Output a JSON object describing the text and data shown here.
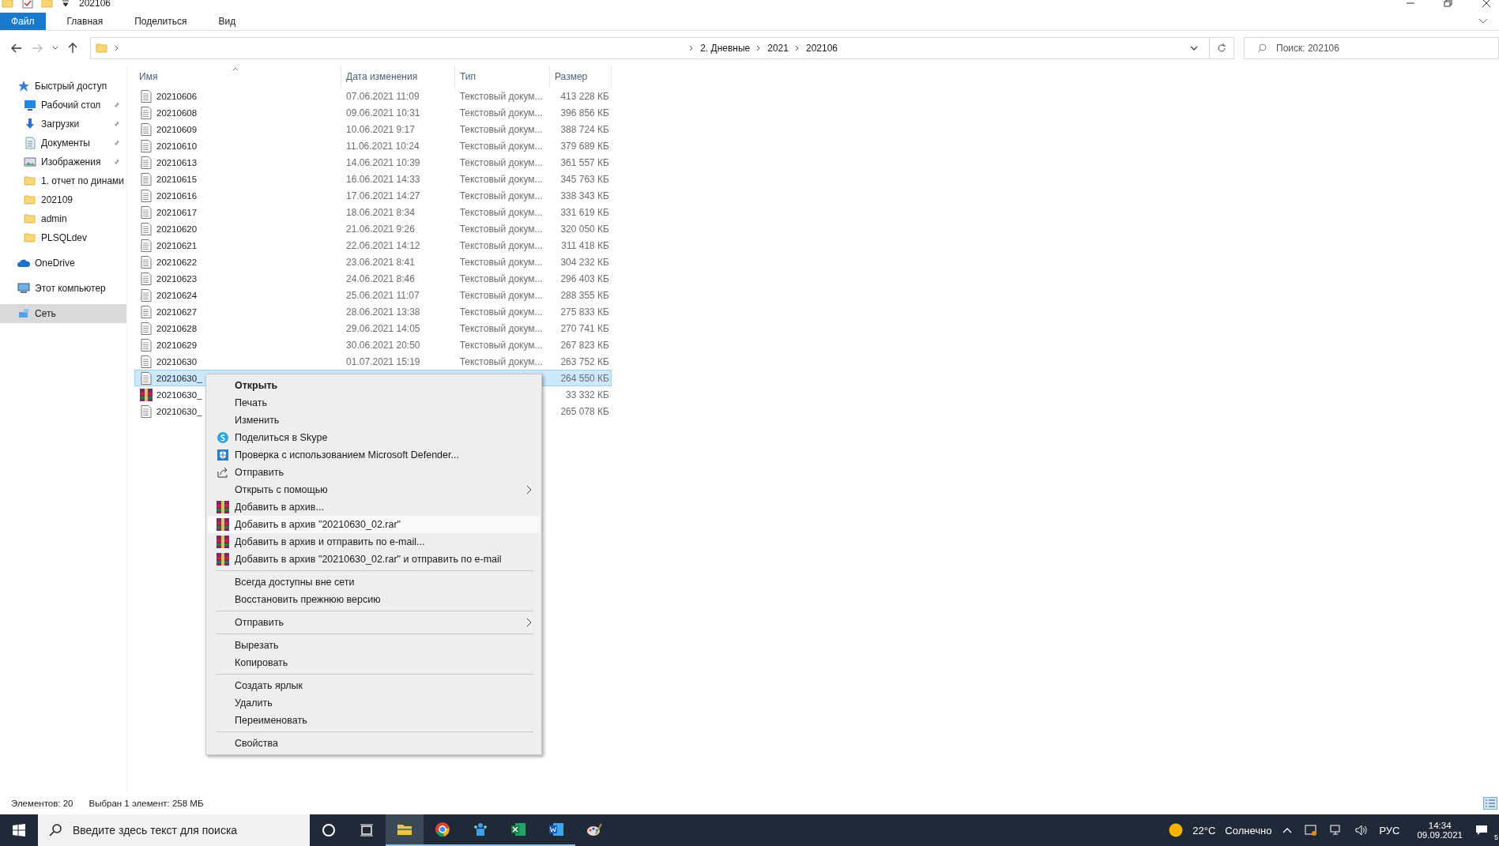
{
  "window": {
    "title": "202106"
  },
  "ribbon": {
    "tabs": [
      {
        "label": "Файл",
        "selected": true
      },
      {
        "label": "Главная",
        "selected": false
      },
      {
        "label": "Поделиться",
        "selected": false
      },
      {
        "label": "Вид",
        "selected": false
      }
    ]
  },
  "address": {
    "breadcrumb": [
      "2. Дневные",
      "2021",
      "202106"
    ],
    "search": {
      "placeholder": "Поиск: 202106"
    }
  },
  "sidebar": {
    "items": [
      {
        "label": "Быстрый доступ",
        "kind": "star",
        "pinned": false,
        "selected": false,
        "children": [
          {
            "label": "Рабочий стол",
            "kind": "desktop",
            "pinned": true,
            "selected": false
          },
          {
            "label": "Загрузки",
            "kind": "download",
            "pinned": true,
            "selected": false
          },
          {
            "label": "Документы",
            "kind": "documents",
            "pinned": true,
            "selected": false
          },
          {
            "label": "Изображения",
            "kind": "pictures",
            "pinned": true,
            "selected": false
          },
          {
            "label": "1. отчет по динами",
            "kind": "folder",
            "pinned": false,
            "selected": false
          },
          {
            "label": "202109",
            "kind": "folder",
            "pinned": false,
            "selected": false
          },
          {
            "label": "admin",
            "kind": "folder",
            "pinned": false,
            "selected": false
          },
          {
            "label": "PLSQLdev",
            "kind": "folder",
            "pinned": false,
            "selected": false
          }
        ]
      },
      {
        "label": "OneDrive",
        "kind": "cloud",
        "pinned": false,
        "selected": false
      },
      {
        "label": "Этот компьютер",
        "kind": "computer",
        "pinned": false,
        "selected": false
      },
      {
        "label": "Сеть",
        "kind": "network",
        "pinned": false,
        "selected": true
      }
    ]
  },
  "table": {
    "columns": [
      "Имя",
      "Дата изменения",
      "Тип",
      "Размер"
    ],
    "rows": [
      {
        "kind": "text",
        "name": "20210606",
        "date": "07.06.2021 11:09",
        "type": "Текстовый докум...",
        "size": "413 228 КБ",
        "selected": false
      },
      {
        "kind": "text",
        "name": "20210608",
        "date": "09.06.2021 10:31",
        "type": "Текстовый докум...",
        "size": "396 856 КБ",
        "selected": false
      },
      {
        "kind": "text",
        "name": "20210609",
        "date": "10.06.2021 9:17",
        "type": "Текстовый докум...",
        "size": "388 724 КБ",
        "selected": false
      },
      {
        "kind": "text",
        "name": "20210610",
        "date": "11.06.2021 10:24",
        "type": "Текстовый докум...",
        "size": "379 689 КБ",
        "selected": false
      },
      {
        "kind": "text",
        "name": "20210613",
        "date": "14.06.2021 10:39",
        "type": "Текстовый докум...",
        "size": "361 557 КБ",
        "selected": false
      },
      {
        "kind": "text",
        "name": "20210615",
        "date": "16.06.2021 14:33",
        "type": "Текстовый докум...",
        "size": "345 763 КБ",
        "selected": false
      },
      {
        "kind": "text",
        "name": "20210616",
        "date": "17.06.2021 14:27",
        "type": "Текстовый докум...",
        "size": "338 343 КБ",
        "selected": false
      },
      {
        "kind": "text",
        "name": "20210617",
        "date": "18.06.2021 8:34",
        "type": "Текстовый докум...",
        "size": "331 619 КБ",
        "selected": false
      },
      {
        "kind": "text",
        "name": "20210620",
        "date": "21.06.2021 9:26",
        "type": "Текстовый докум...",
        "size": "320 050 КБ",
        "selected": false
      },
      {
        "kind": "text",
        "name": "20210621",
        "date": "22.06.2021 14:12",
        "type": "Текстовый докум...",
        "size": "311 418 КБ",
        "selected": false
      },
      {
        "kind": "text",
        "name": "20210622",
        "date": "23.06.2021 8:41",
        "type": "Текстовый докум...",
        "size": "304 232 КБ",
        "selected": false
      },
      {
        "kind": "text",
        "name": "20210623",
        "date": "24.06.2021 8:46",
        "type": "Текстовый докум...",
        "size": "296 403 КБ",
        "selected": false
      },
      {
        "kind": "text",
        "name": "20210624",
        "date": "25.06.2021 11:07",
        "type": "Текстовый докум...",
        "size": "288 355 КБ",
        "selected": false
      },
      {
        "kind": "text",
        "name": "20210627",
        "date": "28.06.2021 13:38",
        "type": "Текстовый докум...",
        "size": "275 833 КБ",
        "selected": false
      },
      {
        "kind": "text",
        "name": "20210628",
        "date": "29.06.2021 14:05",
        "type": "Текстовый докум...",
        "size": "270 741 КБ",
        "selected": false
      },
      {
        "kind": "text",
        "name": "20210629",
        "date": "30.06.2021 20:50",
        "type": "Текстовый докум...",
        "size": "267 823 КБ",
        "selected": false
      },
      {
        "kind": "text",
        "name": "20210630",
        "date": "01.07.2021 15:19",
        "type": "Текстовый докум...",
        "size": "263 752 КБ",
        "selected": false
      },
      {
        "kind": "text",
        "name": "20210630_",
        "size": "264 550 КБ",
        "selected": true
      },
      {
        "kind": "archive",
        "name": "20210630_",
        "size": "33 332 КБ",
        "selected": false
      },
      {
        "kind": "text",
        "name": "20210630_",
        "size": "265 078 КБ",
        "selected": false
      }
    ]
  },
  "context_menu": {
    "groups": [
      [
        {
          "label": "Открыть",
          "kind": "plain",
          "default": true,
          "submenu": false,
          "highlighted": false
        },
        {
          "label": "Печать",
          "kind": "plain",
          "default": false,
          "submenu": false,
          "highlighted": false
        },
        {
          "label": "Изменить",
          "kind": "plain",
          "default": false,
          "submenu": false,
          "highlighted": false
        },
        {
          "label": "Поделиться в Skype",
          "kind": "skype",
          "default": false,
          "submenu": false,
          "highlighted": false
        },
        {
          "label": "Проверка с использованием Microsoft Defender...",
          "kind": "shield",
          "default": false,
          "submenu": false,
          "highlighted": false
        },
        {
          "label": "Отправить",
          "kind": "share",
          "default": false,
          "submenu": false,
          "highlighted": false
        },
        {
          "label": "Открыть с помощью",
          "kind": "plain",
          "default": false,
          "submenu": true,
          "highlighted": false
        },
        {
          "label": "Добавить в архив...",
          "kind": "archive",
          "default": false,
          "submenu": false,
          "highlighted": false
        },
        {
          "label": "Добавить в архив \"20210630_02.rar\"",
          "kind": "archive",
          "default": false,
          "submenu": false,
          "highlighted": true
        },
        {
          "label": "Добавить в архив и отправить по e-mail...",
          "kind": "archive",
          "default": false,
          "submenu": false,
          "highlighted": false
        },
        {
          "label": "Добавить в архив \"20210630_02.rar\" и отправить по e-mail",
          "kind": "archive",
          "default": false,
          "submenu": false,
          "highlighted": false
        }
      ],
      [
        {
          "label": "Всегда доступны вне сети",
          "kind": "plain",
          "default": false,
          "submenu": false,
          "highlighted": false
        },
        {
          "label": "Восстановить прежнюю версию",
          "kind": "plain",
          "default": false,
          "submenu": false,
          "highlighted": false
        }
      ],
      [
        {
          "label": "Отправить",
          "kind": "plain",
          "default": false,
          "submenu": true,
          "highlighted": false
        }
      ],
      [
        {
          "label": "Вырезать",
          "kind": "plain",
          "default": false,
          "submenu": false,
          "highlighted": false
        },
        {
          "label": "Копировать",
          "kind": "plain",
          "default": false,
          "submenu": false,
          "highlighted": false
        }
      ],
      [
        {
          "label": "Создать ярлык",
          "kind": "plain",
          "default": false,
          "submenu": false,
          "highlighted": false
        },
        {
          "label": "Удалить",
          "kind": "plain",
          "default": false,
          "submenu": false,
          "highlighted": false
        },
        {
          "label": "Переименовать",
          "kind": "plain",
          "default": false,
          "submenu": false,
          "highlighted": false
        }
      ],
      [
        {
          "label": "Свойства",
          "kind": "plain",
          "default": false,
          "submenu": false,
          "highlighted": false
        }
      ]
    ]
  },
  "status_bar": {
    "items": [
      "Элементов: 20",
      "Выбран 1 элемент: 258 МБ"
    ]
  },
  "taskbar": {
    "search": {
      "placeholder": "Введите здесь текст для поиска"
    },
    "apps": [
      {
        "kind": "cortana",
        "active": false,
        "open": false
      },
      {
        "kind": "taskview",
        "active": false,
        "open": false
      },
      {
        "kind": "explorer",
        "active": true,
        "open": true
      },
      {
        "kind": "browser",
        "active": false,
        "open": true
      },
      {
        "kind": "people",
        "active": false,
        "open": true
      },
      {
        "kind": "spreadsheet",
        "active": false,
        "open": true
      },
      {
        "kind": "document",
        "active": false,
        "open": true
      },
      {
        "kind": "palette",
        "active": false,
        "open": false
      }
    ],
    "weather": {
      "temperature": "22°C",
      "condition": "Солнечно"
    },
    "language": "РУС",
    "time": "14:34",
    "date": "09.09.2021",
    "notifications": "5"
  }
}
